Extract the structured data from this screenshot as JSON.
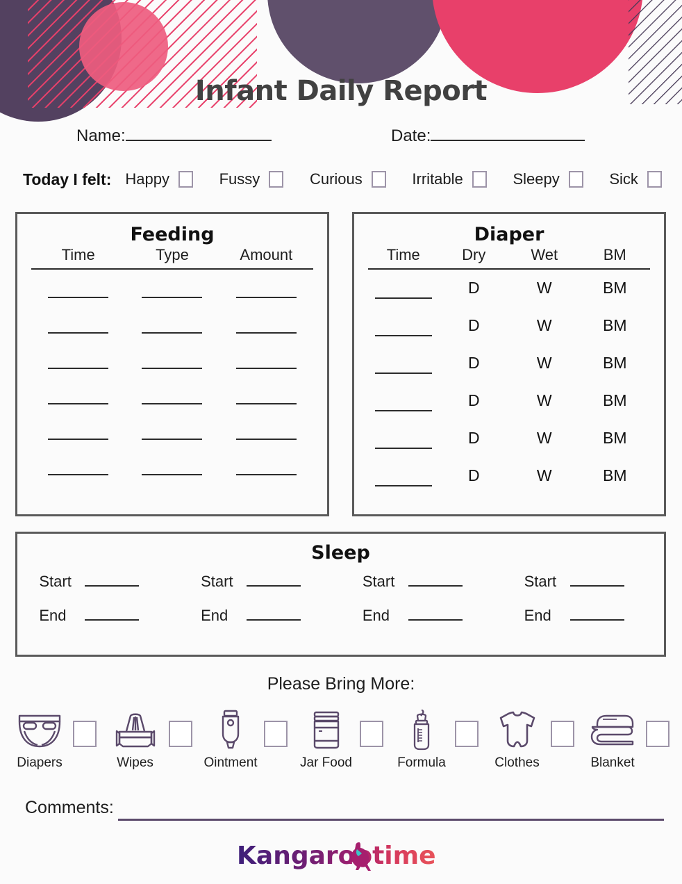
{
  "document": {
    "title": "Infant Daily Report"
  },
  "header_fields": {
    "name_label": "Name:",
    "date_label": "Date:"
  },
  "mood": {
    "title": "Today I felt:",
    "options": [
      {
        "label": "Happy"
      },
      {
        "label": "Fussy"
      },
      {
        "label": "Curious"
      },
      {
        "label": "Irritable"
      },
      {
        "label": "Sleepy"
      },
      {
        "label": "Sick"
      }
    ]
  },
  "feeding": {
    "title": "Feeding",
    "columns": [
      "Time",
      "Type",
      "Amount"
    ],
    "row_count": 6
  },
  "diaper": {
    "title": "Diaper",
    "columns": [
      "Time",
      "Dry",
      "Wet",
      "BM"
    ],
    "marks": [
      "D",
      "W",
      "BM"
    ],
    "row_count": 6
  },
  "sleep": {
    "title": "Sleep",
    "start_label": "Start",
    "end_label": "End",
    "column_count": 4
  },
  "bring_more": {
    "title": "Please Bring More:",
    "items": [
      {
        "label": "Diapers",
        "icon": "diaper-icon"
      },
      {
        "label": "Wipes",
        "icon": "wipes-icon"
      },
      {
        "label": "Ointment",
        "icon": "ointment-tube-icon"
      },
      {
        "label": "Jar Food",
        "icon": "jar-food-icon"
      },
      {
        "label": "Formula",
        "icon": "baby-bottle-icon"
      },
      {
        "label": "Clothes",
        "icon": "onesie-icon"
      },
      {
        "label": "Blanket",
        "icon": "blanket-icon"
      }
    ]
  },
  "comments": {
    "label": "Comments:"
  },
  "footer": {
    "brand_part1": "Kangaroo",
    "brand_part2": "time",
    "brand_full": "Kangarootime"
  },
  "colors": {
    "dark_purple": "#534160",
    "crimson": "#E8406A",
    "pink": "#EE5C7F",
    "title_gray": "#414141",
    "panel_border": "#5a5a5a",
    "icon_purple": "#5b4a6b",
    "checkbox_border": "#9d94a8",
    "logo_purple": "#3d1f7a",
    "logo_magenta": "#a61f6e",
    "logo_red": "#e8444f",
    "logo_teal": "#3ec6c6"
  }
}
